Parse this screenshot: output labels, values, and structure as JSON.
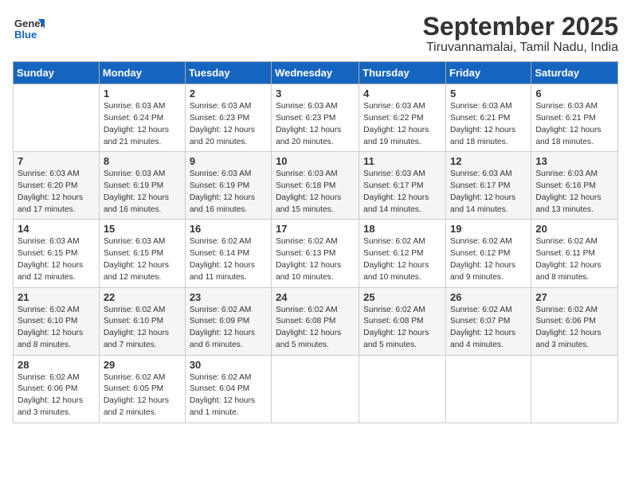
{
  "header": {
    "logo_general": "General",
    "logo_blue": "Blue",
    "title": "September 2025",
    "subtitle": "Tiruvannamalai, Tamil Nadu, India"
  },
  "weekdays": [
    "Sunday",
    "Monday",
    "Tuesday",
    "Wednesday",
    "Thursday",
    "Friday",
    "Saturday"
  ],
  "weeks": [
    [
      {
        "day": "",
        "sunrise": "",
        "sunset": "",
        "daylight": ""
      },
      {
        "day": "1",
        "sunrise": "Sunrise: 6:03 AM",
        "sunset": "Sunset: 6:24 PM",
        "daylight": "Daylight: 12 hours and 21 minutes."
      },
      {
        "day": "2",
        "sunrise": "Sunrise: 6:03 AM",
        "sunset": "Sunset: 6:23 PM",
        "daylight": "Daylight: 12 hours and 20 minutes."
      },
      {
        "day": "3",
        "sunrise": "Sunrise: 6:03 AM",
        "sunset": "Sunset: 6:23 PM",
        "daylight": "Daylight: 12 hours and 20 minutes."
      },
      {
        "day": "4",
        "sunrise": "Sunrise: 6:03 AM",
        "sunset": "Sunset: 6:22 PM",
        "daylight": "Daylight: 12 hours and 19 minutes."
      },
      {
        "day": "5",
        "sunrise": "Sunrise: 6:03 AM",
        "sunset": "Sunset: 6:21 PM",
        "daylight": "Daylight: 12 hours and 18 minutes."
      },
      {
        "day": "6",
        "sunrise": "Sunrise: 6:03 AM",
        "sunset": "Sunset: 6:21 PM",
        "daylight": "Daylight: 12 hours and 18 minutes."
      }
    ],
    [
      {
        "day": "7",
        "sunrise": "Sunrise: 6:03 AM",
        "sunset": "Sunset: 6:20 PM",
        "daylight": "Daylight: 12 hours and 17 minutes."
      },
      {
        "day": "8",
        "sunrise": "Sunrise: 6:03 AM",
        "sunset": "Sunset: 6:19 PM",
        "daylight": "Daylight: 12 hours and 16 minutes."
      },
      {
        "day": "9",
        "sunrise": "Sunrise: 6:03 AM",
        "sunset": "Sunset: 6:19 PM",
        "daylight": "Daylight: 12 hours and 16 minutes."
      },
      {
        "day": "10",
        "sunrise": "Sunrise: 6:03 AM",
        "sunset": "Sunset: 6:18 PM",
        "daylight": "Daylight: 12 hours and 15 minutes."
      },
      {
        "day": "11",
        "sunrise": "Sunrise: 6:03 AM",
        "sunset": "Sunset: 6:17 PM",
        "daylight": "Daylight: 12 hours and 14 minutes."
      },
      {
        "day": "12",
        "sunrise": "Sunrise: 6:03 AM",
        "sunset": "Sunset: 6:17 PM",
        "daylight": "Daylight: 12 hours and 14 minutes."
      },
      {
        "day": "13",
        "sunrise": "Sunrise: 6:03 AM",
        "sunset": "Sunset: 6:16 PM",
        "daylight": "Daylight: 12 hours and 13 minutes."
      }
    ],
    [
      {
        "day": "14",
        "sunrise": "Sunrise: 6:03 AM",
        "sunset": "Sunset: 6:15 PM",
        "daylight": "Daylight: 12 hours and 12 minutes."
      },
      {
        "day": "15",
        "sunrise": "Sunrise: 6:03 AM",
        "sunset": "Sunset: 6:15 PM",
        "daylight": "Daylight: 12 hours and 12 minutes."
      },
      {
        "day": "16",
        "sunrise": "Sunrise: 6:02 AM",
        "sunset": "Sunset: 6:14 PM",
        "daylight": "Daylight: 12 hours and 11 minutes."
      },
      {
        "day": "17",
        "sunrise": "Sunrise: 6:02 AM",
        "sunset": "Sunset: 6:13 PM",
        "daylight": "Daylight: 12 hours and 10 minutes."
      },
      {
        "day": "18",
        "sunrise": "Sunrise: 6:02 AM",
        "sunset": "Sunset: 6:12 PM",
        "daylight": "Daylight: 12 hours and 10 minutes."
      },
      {
        "day": "19",
        "sunrise": "Sunrise: 6:02 AM",
        "sunset": "Sunset: 6:12 PM",
        "daylight": "Daylight: 12 hours and 9 minutes."
      },
      {
        "day": "20",
        "sunrise": "Sunrise: 6:02 AM",
        "sunset": "Sunset: 6:11 PM",
        "daylight": "Daylight: 12 hours and 8 minutes."
      }
    ],
    [
      {
        "day": "21",
        "sunrise": "Sunrise: 6:02 AM",
        "sunset": "Sunset: 6:10 PM",
        "daylight": "Daylight: 12 hours and 8 minutes."
      },
      {
        "day": "22",
        "sunrise": "Sunrise: 6:02 AM",
        "sunset": "Sunset: 6:10 PM",
        "daylight": "Daylight: 12 hours and 7 minutes."
      },
      {
        "day": "23",
        "sunrise": "Sunrise: 6:02 AM",
        "sunset": "Sunset: 6:09 PM",
        "daylight": "Daylight: 12 hours and 6 minutes."
      },
      {
        "day": "24",
        "sunrise": "Sunrise: 6:02 AM",
        "sunset": "Sunset: 6:08 PM",
        "daylight": "Daylight: 12 hours and 5 minutes."
      },
      {
        "day": "25",
        "sunrise": "Sunrise: 6:02 AM",
        "sunset": "Sunset: 6:08 PM",
        "daylight": "Daylight: 12 hours and 5 minutes."
      },
      {
        "day": "26",
        "sunrise": "Sunrise: 6:02 AM",
        "sunset": "Sunset: 6:07 PM",
        "daylight": "Daylight: 12 hours and 4 minutes."
      },
      {
        "day": "27",
        "sunrise": "Sunrise: 6:02 AM",
        "sunset": "Sunset: 6:06 PM",
        "daylight": "Daylight: 12 hours and 3 minutes."
      }
    ],
    [
      {
        "day": "28",
        "sunrise": "Sunrise: 6:02 AM",
        "sunset": "Sunset: 6:06 PM",
        "daylight": "Daylight: 12 hours and 3 minutes."
      },
      {
        "day": "29",
        "sunrise": "Sunrise: 6:02 AM",
        "sunset": "Sunset: 6:05 PM",
        "daylight": "Daylight: 12 hours and 2 minutes."
      },
      {
        "day": "30",
        "sunrise": "Sunrise: 6:02 AM",
        "sunset": "Sunset: 6:04 PM",
        "daylight": "Daylight: 12 hours and 1 minute."
      },
      {
        "day": "",
        "sunrise": "",
        "sunset": "",
        "daylight": ""
      },
      {
        "day": "",
        "sunrise": "",
        "sunset": "",
        "daylight": ""
      },
      {
        "day": "",
        "sunrise": "",
        "sunset": "",
        "daylight": ""
      },
      {
        "day": "",
        "sunrise": "",
        "sunset": "",
        "daylight": ""
      }
    ]
  ]
}
